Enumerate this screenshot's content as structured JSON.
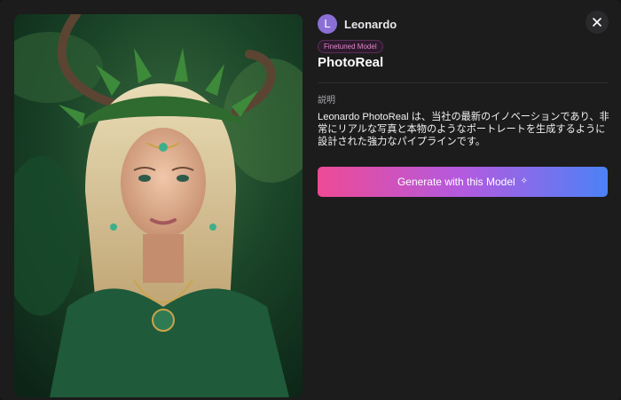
{
  "author": {
    "avatar_letter": "L",
    "name": "Leonardo"
  },
  "model": {
    "badge": "Finetuned Model",
    "name": "PhotoReal"
  },
  "description": {
    "label": "説明",
    "text": "Leonardo PhotoReal は、当社の最新のイノベーションであり、非常にリアルな写真と本物のようなポートレートを生成するように設計された強力なパイプラインです。"
  },
  "actions": {
    "generate_label": "Generate with this Model",
    "generate_icon": "sparkle-icon",
    "close_icon": "close-icon"
  },
  "colors": {
    "avatar": "#8b6fd6",
    "badge_text": "#e089c8",
    "button_gradient_start": "#ee4a95",
    "button_gradient_end": "#4c82f6",
    "background": "#1c1c1c"
  }
}
